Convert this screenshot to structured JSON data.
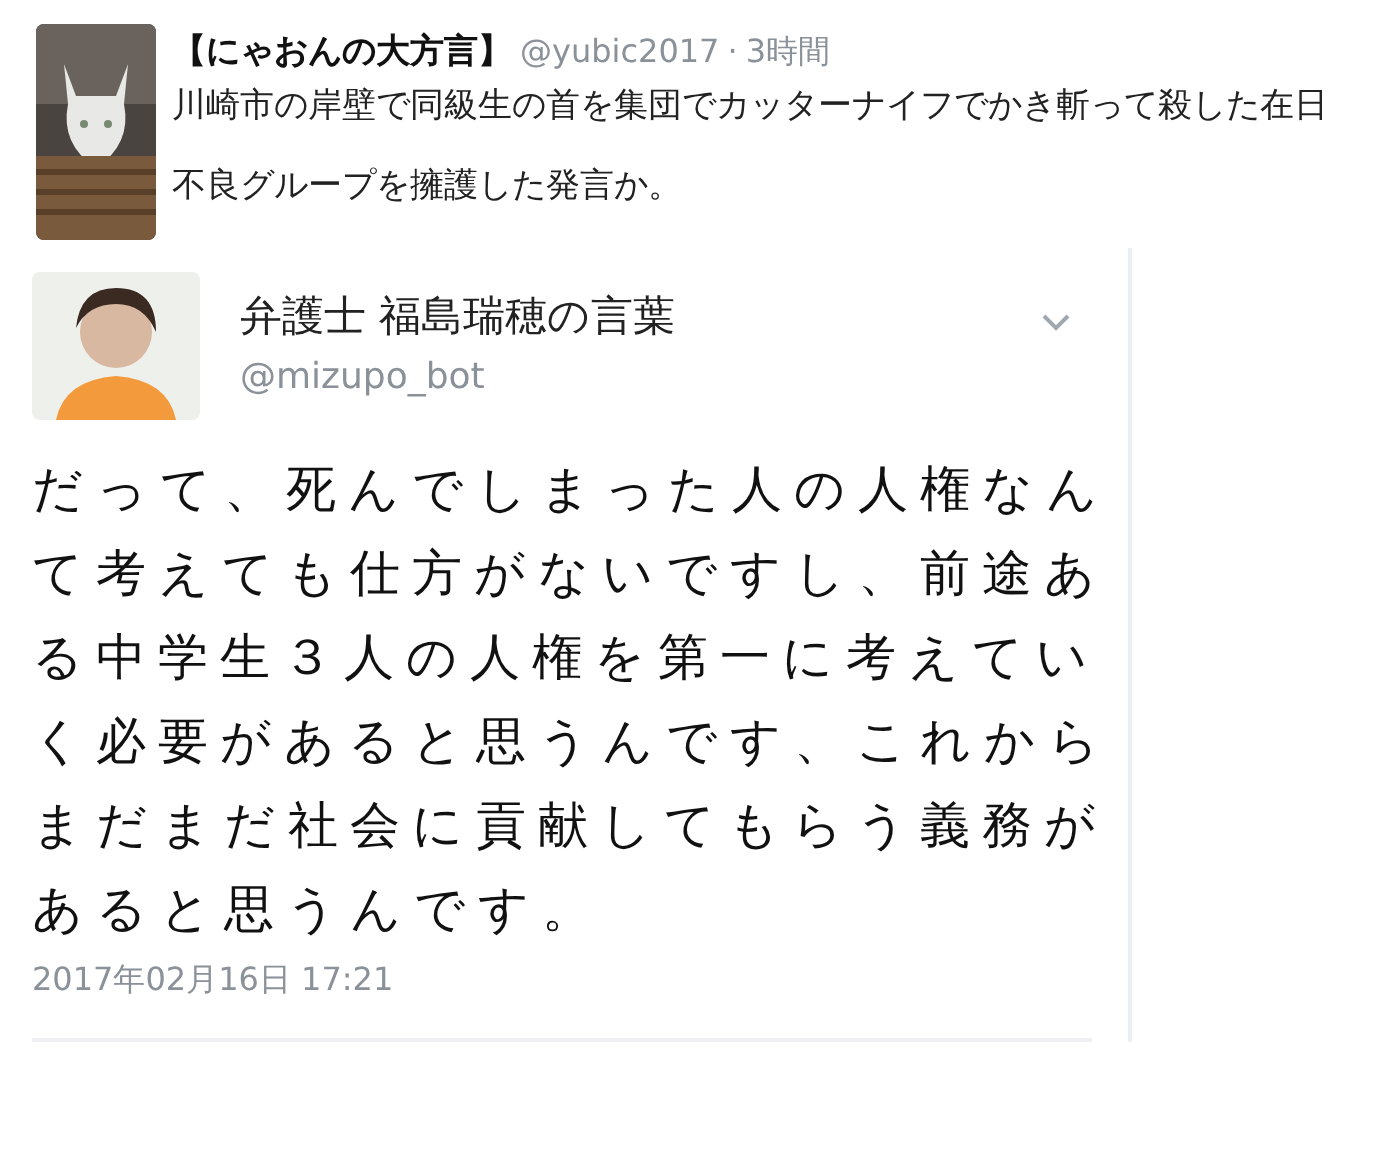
{
  "quote_tweet": {
    "kind": "picture",
    "name": "【にゃおんの大方言】",
    "handle": "@yubic2017",
    "separator": "·",
    "time": "3時間",
    "text": "川崎市の岸壁で同級生の首を集団でカッターナイフでかき斬って殺した在日不良グループを擁護した発言か。"
  },
  "tweet": {
    "name": "弁護士 福島瑞穂の言葉",
    "handle": "@mizupo_bot",
    "text": "だって、死んでしまった人の人権なんて考えても仕方がないですし、前途ある中学生３人の人権を第一に考えていく必要があると思うんです、これからまだまだ社会に貢献してもらう義務があると思うんです。",
    "date": "2017年02月16日 17:21"
  }
}
